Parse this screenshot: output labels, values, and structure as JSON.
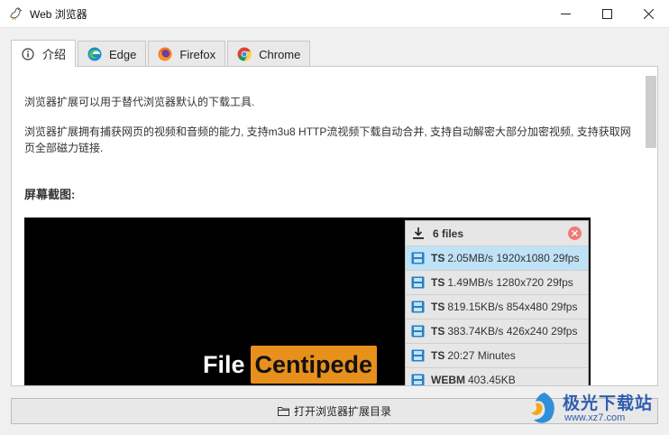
{
  "window": {
    "title": "Web 浏览器"
  },
  "tabs": [
    {
      "label": "介绍",
      "icon": "info-icon",
      "active": true
    },
    {
      "label": "Edge",
      "icon": "edge-icon",
      "active": false
    },
    {
      "label": "Firefox",
      "icon": "firefox-icon",
      "active": false
    },
    {
      "label": "Chrome",
      "icon": "chrome-icon",
      "active": false
    }
  ],
  "intro": {
    "paragraph1": "浏览器扩展可以用于替代浏览器默认的下载工具.",
    "paragraph2": " 浏览器扩展拥有捕获网页的视频和音频的能力, 支持m3u8 HTTP流视频下载自动合并, 支持自动解密大部分加密视频, 支持获取网页全部磁力链接.",
    "screenshot_title": "屏幕截图:"
  },
  "screenshot": {
    "file_word": "File",
    "centipede_word": "Centipede",
    "popup": {
      "header": "6 files",
      "rows": [
        {
          "type": "TS",
          "detail": "2.05MB/s 1920x1080 29fps",
          "selected": true
        },
        {
          "type": "TS",
          "detail": "1.49MB/s 1280x720 29fps",
          "selected": false
        },
        {
          "type": "TS",
          "detail": "819.15KB/s 854x480 29fps",
          "selected": false
        },
        {
          "type": "TS",
          "detail": "383.74KB/s 426x240 29fps",
          "selected": false
        },
        {
          "type": "TS",
          "detail": "20:27 Minutes",
          "selected": false
        },
        {
          "type": "WEBM",
          "detail": "403.45KB",
          "selected": false
        }
      ]
    }
  },
  "bottom_button": {
    "label": "打开浏览器扩展目录"
  },
  "watermark": {
    "brand": "极光下载站",
    "url": "www.xz7.com"
  },
  "colors": {
    "accent_orange": "#e8901c",
    "selected_row": "#bfe2f6",
    "close_red": "#f07a7a",
    "watermark_blue": "#2f5db0"
  }
}
